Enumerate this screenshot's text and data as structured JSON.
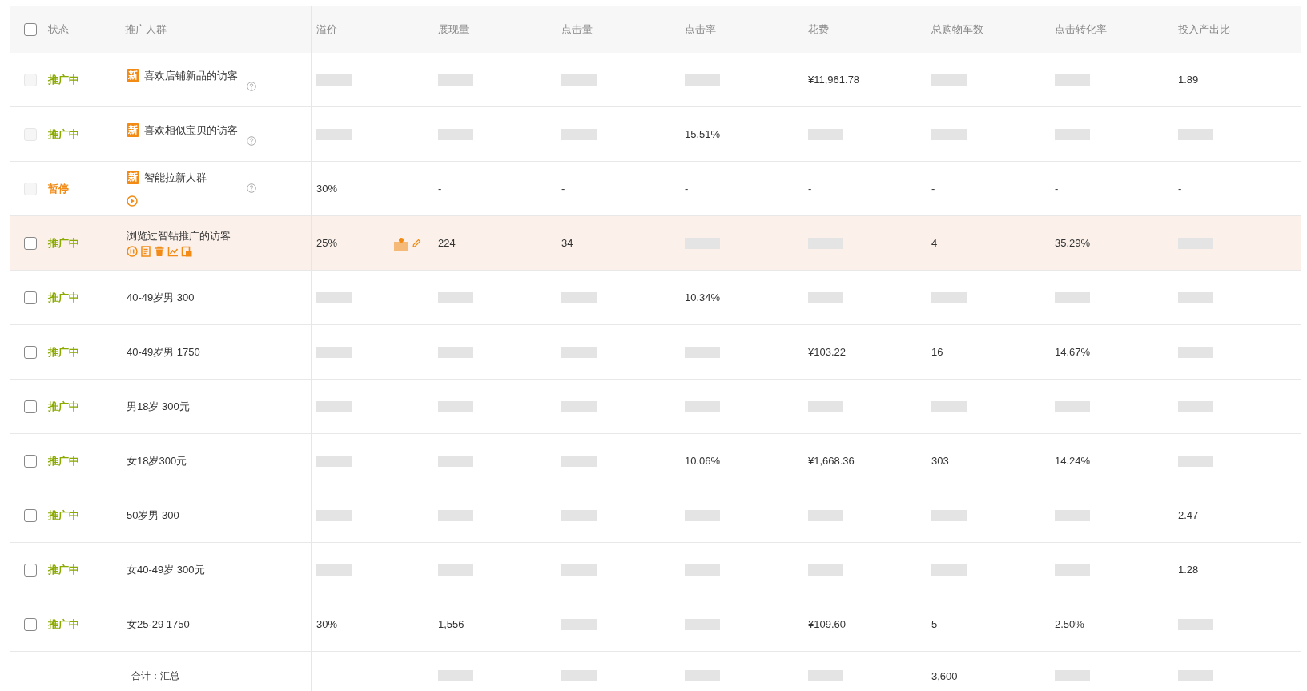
{
  "table": {
    "header_checkbox": {
      "checked": false
    },
    "fixed_columns": [
      "状态",
      "推广人群"
    ],
    "columns": [
      "溢价",
      "展现量",
      "点击量",
      "点击率",
      "花费",
      "总购物车数",
      "点击转化率",
      "投入产出比"
    ],
    "rows": [
      {
        "checkbox": {
          "checked": false,
          "disabled": true
        },
        "status": {
          "text": "推广中",
          "kind": "active"
        },
        "audience": {
          "badge": "新",
          "name": "喜欢店铺新品的访客",
          "help": true
        },
        "highlighted": false,
        "cells": [
          {
            "redacted": true
          },
          {
            "redacted": true
          },
          {
            "redacted": true
          },
          {
            "redacted": true
          },
          {
            "text": "¥11,961.78"
          },
          {
            "redacted": true
          },
          {
            "redacted": true
          },
          {
            "text": "1.89"
          }
        ]
      },
      {
        "checkbox": {
          "checked": false,
          "disabled": true
        },
        "status": {
          "text": "推广中",
          "kind": "active"
        },
        "audience": {
          "badge": "新",
          "name": "喜欢相似宝贝的访客",
          "help": true
        },
        "highlighted": false,
        "cells": [
          {
            "redacted": true
          },
          {
            "redacted": true
          },
          {
            "redacted": true
          },
          {
            "text": "15.51%"
          },
          {
            "redacted": true
          },
          {
            "redacted": true
          },
          {
            "redacted": true
          },
          {
            "redacted": true
          }
        ]
      },
      {
        "checkbox": {
          "checked": false,
          "disabled": true
        },
        "status": {
          "text": "暂停",
          "kind": "paused"
        },
        "audience": {
          "badge": "新",
          "name": "智能拉新人群",
          "help": true,
          "actions": [
            {
              "kind": "play"
            }
          ]
        },
        "highlighted": false,
        "cells": [
          {
            "text": "30%"
          },
          {
            "text": "-"
          },
          {
            "text": "-"
          },
          {
            "text": "-"
          },
          {
            "text": "-"
          },
          {
            "text": "-"
          },
          {
            "text": "-"
          },
          {
            "text": "-"
          }
        ]
      },
      {
        "checkbox": {
          "checked": false,
          "disabled": false
        },
        "status": {
          "text": "推广中",
          "kind": "active"
        },
        "audience": {
          "name": "浏览过智钻推广的访客",
          "actions": [
            {
              "kind": "pause"
            },
            {
              "kind": "note"
            },
            {
              "kind": "delete"
            },
            {
              "kind": "chart"
            },
            {
              "kind": "report"
            }
          ]
        },
        "premium_tools": true,
        "highlighted": true,
        "cells": [
          {
            "text": "25%"
          },
          {
            "text": "224"
          },
          {
            "text": "34"
          },
          {
            "redacted": true
          },
          {
            "redacted": true
          },
          {
            "text": "4"
          },
          {
            "text": "35.29%"
          },
          {
            "redacted": true
          }
        ]
      },
      {
        "checkbox": {
          "checked": false,
          "disabled": false
        },
        "status": {
          "text": "推广中",
          "kind": "active"
        },
        "audience": {
          "name": "40-49岁男 300"
        },
        "highlighted": false,
        "cells": [
          {
            "redacted": true
          },
          {
            "redacted": true
          },
          {
            "redacted": true
          },
          {
            "text": "10.34%"
          },
          {
            "redacted": true
          },
          {
            "redacted": true
          },
          {
            "redacted": true
          },
          {
            "redacted": true
          }
        ]
      },
      {
        "checkbox": {
          "checked": false,
          "disabled": false
        },
        "status": {
          "text": "推广中",
          "kind": "active"
        },
        "audience": {
          "name": "40-49岁男 1750"
        },
        "highlighted": false,
        "cells": [
          {
            "redacted": true
          },
          {
            "redacted": true
          },
          {
            "redacted": true
          },
          {
            "redacted": true
          },
          {
            "text": "¥103.22"
          },
          {
            "text": "16"
          },
          {
            "text": "14.67%"
          },
          {
            "redacted": true
          }
        ]
      },
      {
        "checkbox": {
          "checked": false,
          "disabled": false
        },
        "status": {
          "text": "推广中",
          "kind": "active"
        },
        "audience": {
          "name": "男18岁 300元"
        },
        "highlighted": false,
        "cells": [
          {
            "redacted": true
          },
          {
            "redacted": true
          },
          {
            "redacted": true
          },
          {
            "redacted": true
          },
          {
            "redacted": true
          },
          {
            "redacted": true
          },
          {
            "redacted": true
          },
          {
            "redacted": true
          }
        ]
      },
      {
        "checkbox": {
          "checked": false,
          "disabled": false
        },
        "status": {
          "text": "推广中",
          "kind": "active"
        },
        "audience": {
          "name": "女18岁300元"
        },
        "highlighted": false,
        "cells": [
          {
            "redacted": true
          },
          {
            "redacted": true
          },
          {
            "redacted": true
          },
          {
            "text": "10.06%"
          },
          {
            "text": "¥1,668.36"
          },
          {
            "text": "303"
          },
          {
            "text": "14.24%"
          },
          {
            "redacted": true
          }
        ]
      },
      {
        "checkbox": {
          "checked": false,
          "disabled": false
        },
        "status": {
          "text": "推广中",
          "kind": "active"
        },
        "audience": {
          "name": "50岁男 300"
        },
        "highlighted": false,
        "cells": [
          {
            "redacted": true
          },
          {
            "redacted": true
          },
          {
            "redacted": true
          },
          {
            "redacted": true
          },
          {
            "redacted": true
          },
          {
            "redacted": true
          },
          {
            "redacted": true
          },
          {
            "text": "2.47"
          }
        ]
      },
      {
        "checkbox": {
          "checked": false,
          "disabled": false
        },
        "status": {
          "text": "推广中",
          "kind": "active"
        },
        "audience": {
          "name": "女40-49岁 300元"
        },
        "highlighted": false,
        "cells": [
          {
            "redacted": true
          },
          {
            "redacted": true
          },
          {
            "redacted": true
          },
          {
            "redacted": true
          },
          {
            "redacted": true
          },
          {
            "redacted": true
          },
          {
            "redacted": true
          },
          {
            "text": "1.28"
          }
        ]
      },
      {
        "checkbox": {
          "checked": false,
          "disabled": false
        },
        "status": {
          "text": "推广中",
          "kind": "active"
        },
        "audience": {
          "name": "女25-29 1750"
        },
        "highlighted": false,
        "cells": [
          {
            "text": "30%"
          },
          {
            "text": "1,556"
          },
          {
            "redacted": true
          },
          {
            "redacted": true
          },
          {
            "text": "¥109.60"
          },
          {
            "text": "5"
          },
          {
            "text": "2.50%"
          },
          {
            "redacted": true
          }
        ]
      }
    ],
    "total": {
      "label": "合计：汇总",
      "cells": [
        null,
        {
          "redacted": true
        },
        {
          "redacted": true
        },
        {
          "redacted": true
        },
        {
          "redacted": true
        },
        {
          "text": "3,600"
        },
        {
          "redacted": true
        },
        {
          "redacted": true
        }
      ]
    }
  }
}
